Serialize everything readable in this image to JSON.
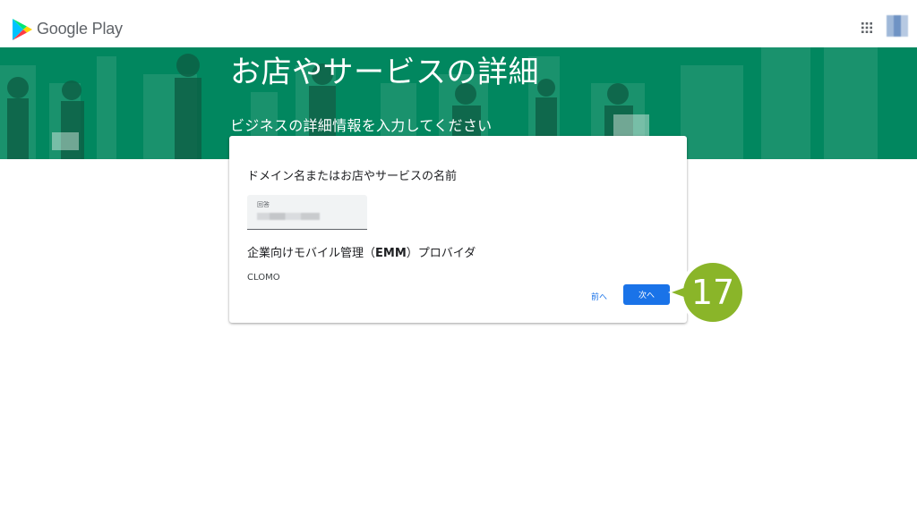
{
  "header": {
    "brand": "Google Play",
    "icons": {
      "logo": "google-play-logo",
      "apps": "apps-grid-icon",
      "account": "account-avatar"
    }
  },
  "hero": {
    "title": "お店やサービスの詳細",
    "subtitle": "ビジネスの詳細情報を入力してください",
    "background_color": "#01875f"
  },
  "form": {
    "question1": "ドメイン名またはお店やサービスの名前",
    "answer_field_label": "回答",
    "question2_before": "企業向けモバイル管理（",
    "question2_bold": "EMM",
    "question2_after": "）プロバイダ",
    "answer2": "CLOMO",
    "prev_label": "前へ",
    "next_label": "次へ",
    "accent_color": "#1a73e8"
  },
  "annotation": {
    "step_number": "17",
    "color": "#8ab529"
  }
}
